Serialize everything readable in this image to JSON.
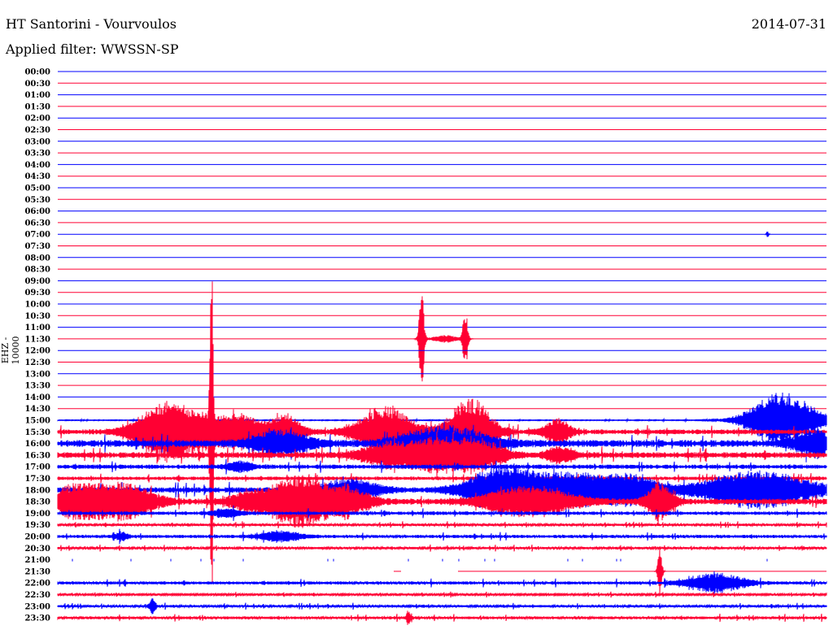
{
  "header": {
    "title": "HT Santorini - Vourvoulos",
    "date": "2014-07-31",
    "filter": "Applied filter: WWSSN-SP"
  },
  "chart_data": {
    "type": "line",
    "title": "HT Santorini - Vourvoulos",
    "subtitle": "Applied filter: WWSSN-SP",
    "ylabel": "EHZ - 10000",
    "row_minutes": 30,
    "colors": [
      "#0000ff",
      "#ff0033"
    ],
    "rows": [
      "00:00",
      "00:30",
      "01:00",
      "01:30",
      "02:00",
      "02:30",
      "03:00",
      "03:30",
      "04:00",
      "04:30",
      "05:00",
      "05:30",
      "06:00",
      "06:30",
      "07:00",
      "07:30",
      "08:00",
      "08:30",
      "09:00",
      "09:30",
      "10:00",
      "10:30",
      "11:00",
      "11:30",
      "12:00",
      "12:30",
      "13:00",
      "13:30",
      "14:00",
      "14:30",
      "15:00",
      "15:30",
      "16:00",
      "16:30",
      "17:00",
      "17:30",
      "18:00",
      "18:30",
      "19:00",
      "19:30",
      "20:00",
      "20:30",
      "21:00",
      "21:30",
      "22:00",
      "22:30",
      "23:00",
      "23:30"
    ],
    "noise": {
      "15:00": 0.4,
      "15:30": 2.5,
      "16:00": 3.5,
      "16:30": 3,
      "17:00": 2.2,
      "17:30": 1.8,
      "18:00": 2.8,
      "18:30": 3,
      "19:00": 1.8,
      "19:30": 1.2,
      "20:00": 1.6,
      "20:30": 1.2,
      "22:00": 1.6,
      "22:30": 1,
      "23:00": 1.2,
      "23:30": 1.4
    },
    "events": [
      {
        "row": "07:00",
        "minute": 27.7,
        "amp": 4,
        "dur": 0.05
      },
      {
        "row": "11:30",
        "minute": 14.2,
        "amp": 60,
        "dur": 0.12
      },
      {
        "row": "11:30",
        "minute": 15.1,
        "amp": 5,
        "dur": 0.6
      },
      {
        "row": "11:30",
        "minute": 15.9,
        "amp": 38,
        "dur": 0.12
      },
      {
        "row": "15:00",
        "minute": 28.3,
        "amp": 35,
        "dur": 1.5
      },
      {
        "row": "15:30",
        "minute": 4.1,
        "amp": 25,
        "dur": 1.3
      },
      {
        "row": "15:30",
        "minute": 5.4,
        "amp": 18,
        "dur": 2.0
      },
      {
        "row": "15:30",
        "minute": 6.0,
        "amp": 220,
        "dur": 0.08
      },
      {
        "row": "15:30",
        "minute": 7.3,
        "amp": 14,
        "dur": 1.0
      },
      {
        "row": "15:30",
        "minute": 8.9,
        "amp": 20,
        "dur": 0.7
      },
      {
        "row": "15:30",
        "minute": 12.8,
        "amp": 30,
        "dur": 1.3
      },
      {
        "row": "15:30",
        "minute": 16.1,
        "amp": 42,
        "dur": 1.0
      },
      {
        "row": "15:30",
        "minute": 19.5,
        "amp": 15,
        "dur": 0.6
      },
      {
        "row": "16:00",
        "minute": 8.7,
        "amp": 15,
        "dur": 1.3
      },
      {
        "row": "16:00",
        "minute": 15.1,
        "amp": 20,
        "dur": 2.0
      },
      {
        "row": "16:00",
        "minute": 29.6,
        "amp": 15,
        "dur": 1.0
      },
      {
        "row": "16:30",
        "minute": 13.0,
        "amp": 15,
        "dur": 1.3
      },
      {
        "row": "16:30",
        "minute": 14.6,
        "amp": 14,
        "dur": 1.0
      },
      {
        "row": "16:30",
        "minute": 16.2,
        "amp": 20,
        "dur": 1.3
      },
      {
        "row": "16:30",
        "minute": 19.6,
        "amp": 10,
        "dur": 0.6
      },
      {
        "row": "17:00",
        "minute": 7.1,
        "amp": 6,
        "dur": 0.6
      },
      {
        "row": "18:00",
        "minute": 11.4,
        "amp": 12,
        "dur": 1.3
      },
      {
        "row": "18:00",
        "minute": 17.3,
        "amp": 26,
        "dur": 1.6
      },
      {
        "row": "18:00",
        "minute": 20.0,
        "amp": 20,
        "dur": 2.0
      },
      {
        "row": "18:00",
        "minute": 22.4,
        "amp": 15,
        "dur": 1.3
      },
      {
        "row": "18:00",
        "minute": 27.3,
        "amp": 22,
        "dur": 2.5
      },
      {
        "row": "18:30",
        "minute": 0.8,
        "amp": 20,
        "dur": 1.3
      },
      {
        "row": "18:30",
        "minute": 2.7,
        "amp": 20,
        "dur": 1.3
      },
      {
        "row": "18:30",
        "minute": 7.6,
        "amp": 12,
        "dur": 1.0
      },
      {
        "row": "18:30",
        "minute": 9.5,
        "amp": 32,
        "dur": 1.3
      },
      {
        "row": "18:30",
        "minute": 11.4,
        "amp": 15,
        "dur": 1.0
      },
      {
        "row": "18:30",
        "minute": 18.4,
        "amp": 18,
        "dur": 2.0
      },
      {
        "row": "18:30",
        "minute": 23.5,
        "amp": 22,
        "dur": 0.6
      },
      {
        "row": "19:00",
        "minute": 6.6,
        "amp": 5,
        "dur": 0.6
      },
      {
        "row": "20:00",
        "minute": 2.5,
        "amp": 5,
        "dur": 0.3
      },
      {
        "row": "20:00",
        "minute": 8.7,
        "amp": 6,
        "dur": 1.0
      },
      {
        "row": "21:30",
        "minute": 23.5,
        "amp": 30,
        "dur": 0.1
      },
      {
        "row": "22:00",
        "minute": 25.7,
        "amp": 11,
        "dur": 1.3
      },
      {
        "row": "23:00",
        "minute": 3.7,
        "amp": 9,
        "dur": 0.15
      },
      {
        "row": "23:30",
        "minute": 13.7,
        "amp": 10,
        "dur": 0.1
      }
    ],
    "gaps": [
      {
        "row": "21:00",
        "from": 0,
        "to": 30
      },
      {
        "row": "21:30",
        "from": 0,
        "to": 13.1
      },
      {
        "row": "21:30",
        "from": 13.4,
        "to": 15.6
      }
    ]
  }
}
